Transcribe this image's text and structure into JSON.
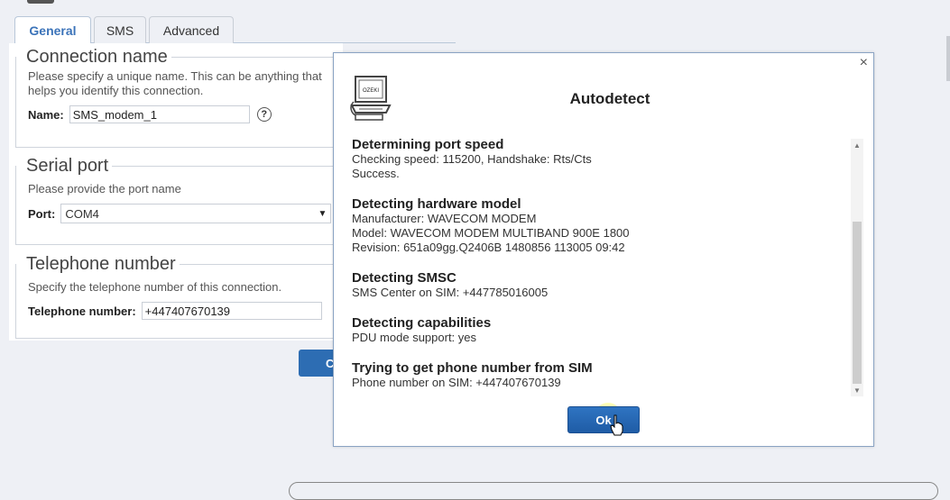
{
  "tabs": [
    {
      "label": "General"
    },
    {
      "label": "SMS"
    },
    {
      "label": "Advanced"
    }
  ],
  "connection": {
    "legend": "Connection name",
    "hint": "Please specify a unique name. This can be anything that helps you identify this connection.",
    "name_label": "Name:",
    "name_value": "SMS_modem_1",
    "help_glyph": "?"
  },
  "serial": {
    "legend": "Serial port",
    "hint": "Please provide the port name",
    "port_label": "Port:",
    "port_value": "COM4"
  },
  "telephone": {
    "legend": "Telephone number",
    "hint": "Specify the telephone number of this connection.",
    "label": "Telephone number:",
    "value": "+447407670139"
  },
  "background_button": {
    "label": "C"
  },
  "dialog": {
    "title": "Autodetect",
    "close_glyph": "×",
    "logo_text": "OZEKI",
    "ok_label": "Ok",
    "sections": [
      {
        "heading": "Determining port speed",
        "lines": [
          "Checking speed: 115200, Handshake: Rts/Cts",
          "Success."
        ]
      },
      {
        "heading": "Detecting hardware model",
        "lines": [
          "Manufacturer: WAVECOM MODEM",
          "Model: WAVECOM MODEM MULTIBAND 900E 1800",
          "Revision: 651a09gg.Q2406B 1480856 113005 09:42"
        ]
      },
      {
        "heading": "Detecting SMSC",
        "lines": [
          "SMS Center on SIM: +447785016005"
        ]
      },
      {
        "heading": "Detecting capabilities",
        "lines": [
          "PDU mode support: yes"
        ]
      },
      {
        "heading": "Trying to get phone number from SIM",
        "lines": [
          "Phone number on SIM: +447407670139"
        ]
      }
    ]
  },
  "icons": [
    "close-icon",
    "help-icon",
    "dropdown-arrow-icon",
    "ozeki-computer-icon",
    "hand-cursor-icon",
    "scroll-up-icon",
    "scroll-down-icon"
  ],
  "colors": {
    "accent": "#3b73b9",
    "button": "#2d6db3",
    "background": "#eef0f5"
  }
}
